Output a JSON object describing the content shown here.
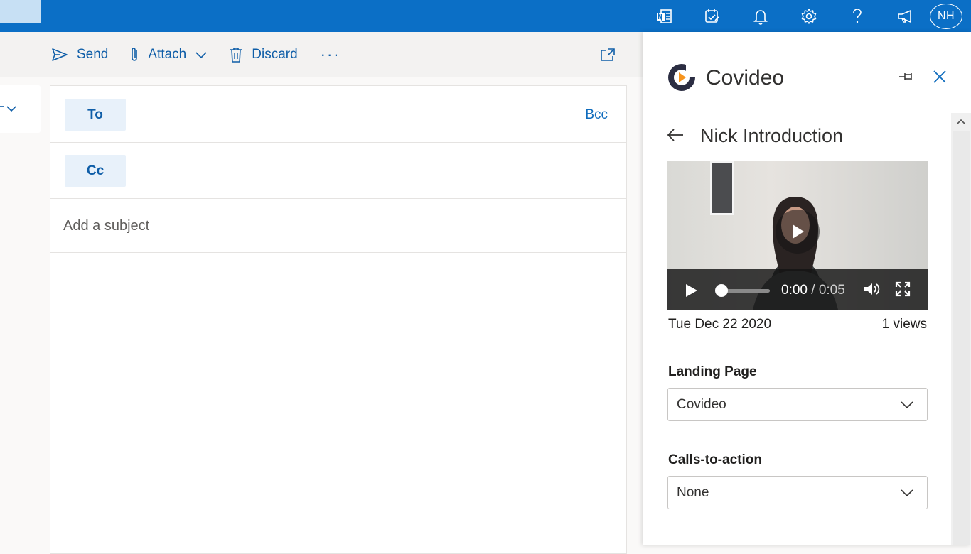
{
  "topbar": {
    "avatar_initials": "NH",
    "icons": [
      "onenote-icon",
      "todo-icon",
      "bell-icon",
      "gear-icon",
      "help-icon",
      "feedback-icon"
    ]
  },
  "toolbar": {
    "send_label": "Send",
    "attach_label": "Attach",
    "discard_label": "Discard",
    "more_label": "···"
  },
  "compose": {
    "to_label": "To",
    "cc_label": "Cc",
    "bcc_label": "Bcc",
    "subject_placeholder": "Add a subject"
  },
  "panel": {
    "title": "Covideo",
    "video_title": "Nick Introduction",
    "current_time": "0:00",
    "separator": " / ",
    "duration": "0:05",
    "date": "Tue Dec 22 2020",
    "views": "1 views",
    "landing_page_label": "Landing Page",
    "landing_page_value": "Covideo",
    "cta_label": "Calls-to-action",
    "cta_value": "None",
    "playback_progress": 0
  },
  "colors": {
    "topbar": "#0b6fc6",
    "accent": "#0f5ea8",
    "pill_bg": "#e8f1fa"
  }
}
